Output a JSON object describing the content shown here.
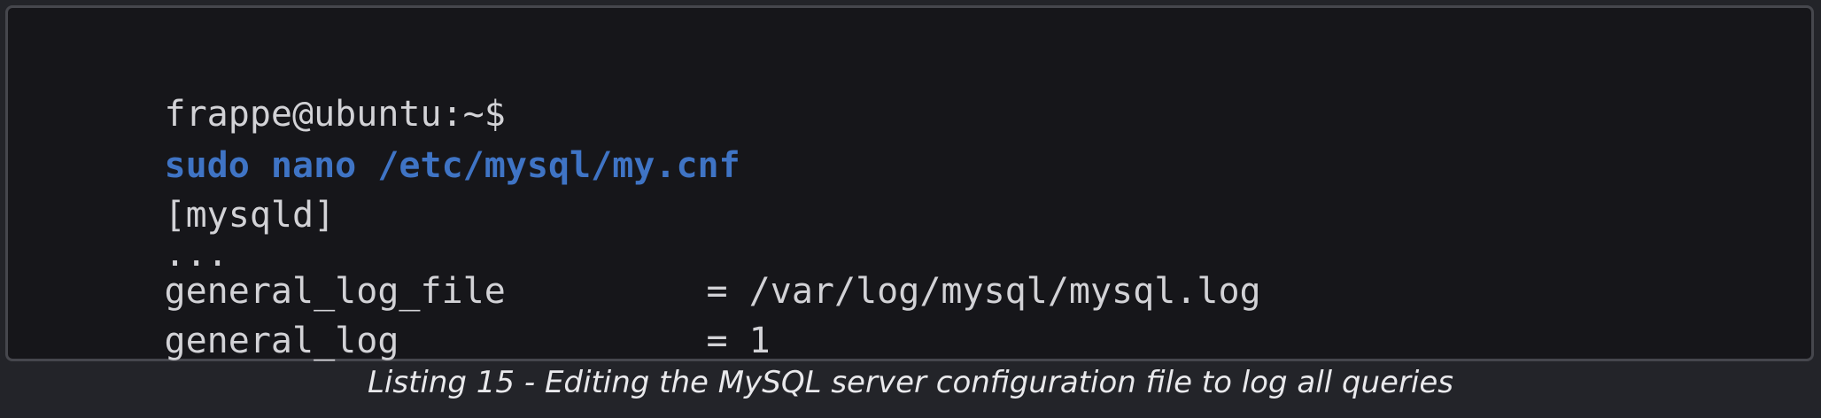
{
  "terminal": {
    "prompt": "frappe@ubuntu:~$",
    "command": "sudo nano /etc/mysql/my.cnf",
    "section_header": "[mysqld]",
    "ellipsis": "...",
    "settings": [
      {
        "key": "general_log_file",
        "value": "= /var/log/mysql/mysql.log"
      },
      {
        "key": "general_log",
        "value": "= 1"
      }
    ]
  },
  "caption": "Listing 15 - Editing the MySQL server configuration file to log all queries",
  "colors": {
    "background": "#232429",
    "terminal_background": "#16161a",
    "terminal_border": "#46474d",
    "text": "#d2d2d6",
    "command": "#3f74c5",
    "caption": "#e9e9ec"
  }
}
